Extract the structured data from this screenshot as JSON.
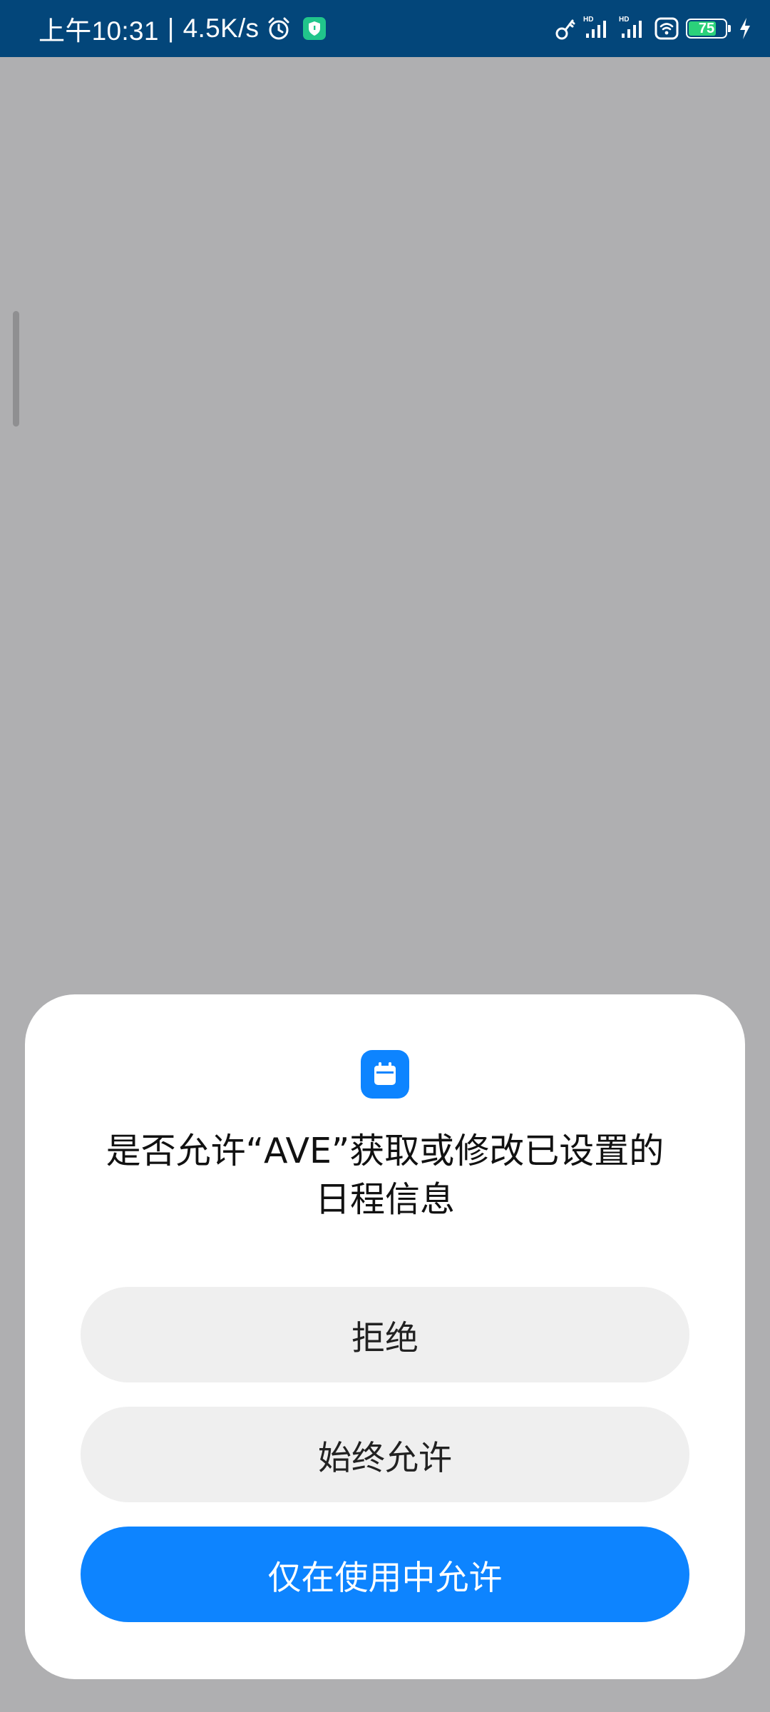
{
  "status_bar": {
    "time": "上午10:31",
    "separator": "|",
    "net_speed": "4.5K/s",
    "battery_level": 75,
    "battery_text": "75",
    "signal_badge_1": "HD",
    "signal_badge_2": "HD",
    "icons": [
      "alarm-icon",
      "shield-app-icon",
      "key-icon",
      "signal-hd-icon",
      "signal-hd-icon",
      "wifi-icon",
      "battery-icon",
      "charging-bolt-icon"
    ],
    "bg_color": "#03467a"
  },
  "dialog": {
    "icon": "calendar-icon",
    "title_line1": "是否允许“AVE”获取或修改已设置的",
    "title_line2": "日程信息",
    "buttons": {
      "deny": "拒绝",
      "always_allow": "始终允许",
      "allow_while_using": "仅在使用中允许"
    },
    "accent_color": "#0d84ff"
  }
}
